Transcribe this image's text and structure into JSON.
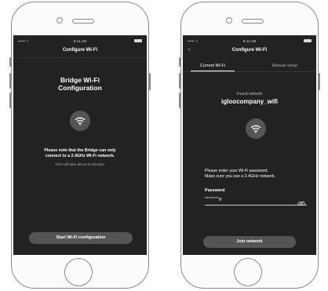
{
  "colors": {
    "screen_bg": "#222222",
    "accent_button": "#555555",
    "text_primary": "#ffffff",
    "text_secondary": "#aaaaaa",
    "device_outline": "#8a8a8a"
  },
  "left_phone": {
    "status": {
      "carrier": "••••• ▿",
      "time": "9:41 AM"
    },
    "nav_title": "Configure Wi-Fi",
    "heading_line1": "Bridge Wi-Fi",
    "heading_line2": "Configuration",
    "icon": "wifi-icon",
    "note_line1": "Please note that the Bridge can only",
    "note_line2": "connect to a 2.4GHz Wi-Fi network.",
    "note_sub": "This will take about 5 minutes.",
    "start_button_label": "Start Wi-Fi configuration"
  },
  "right_phone": {
    "status": {
      "carrier": "••••• ▿",
      "time": "9:41 AM"
    },
    "back_icon": "chevron-left-icon",
    "nav_title": "Configure Wi-Fi",
    "tabs": [
      {
        "label": "Current Wi-Fi",
        "active": true
      },
      {
        "label": "Manual setup",
        "active": false
      }
    ],
    "found_label": "Found network",
    "network_name": "igloocompany_wifi",
    "icon": "wifi-icon",
    "instruction_line1": "Please enter your Wi-Fi password.",
    "instruction_line2": "Make sure you use a 2.4GHz network.",
    "password_label": "Password",
    "password_value": "*******g",
    "visibility_icon": "eye-slash-icon",
    "join_button_label": "Join network"
  }
}
